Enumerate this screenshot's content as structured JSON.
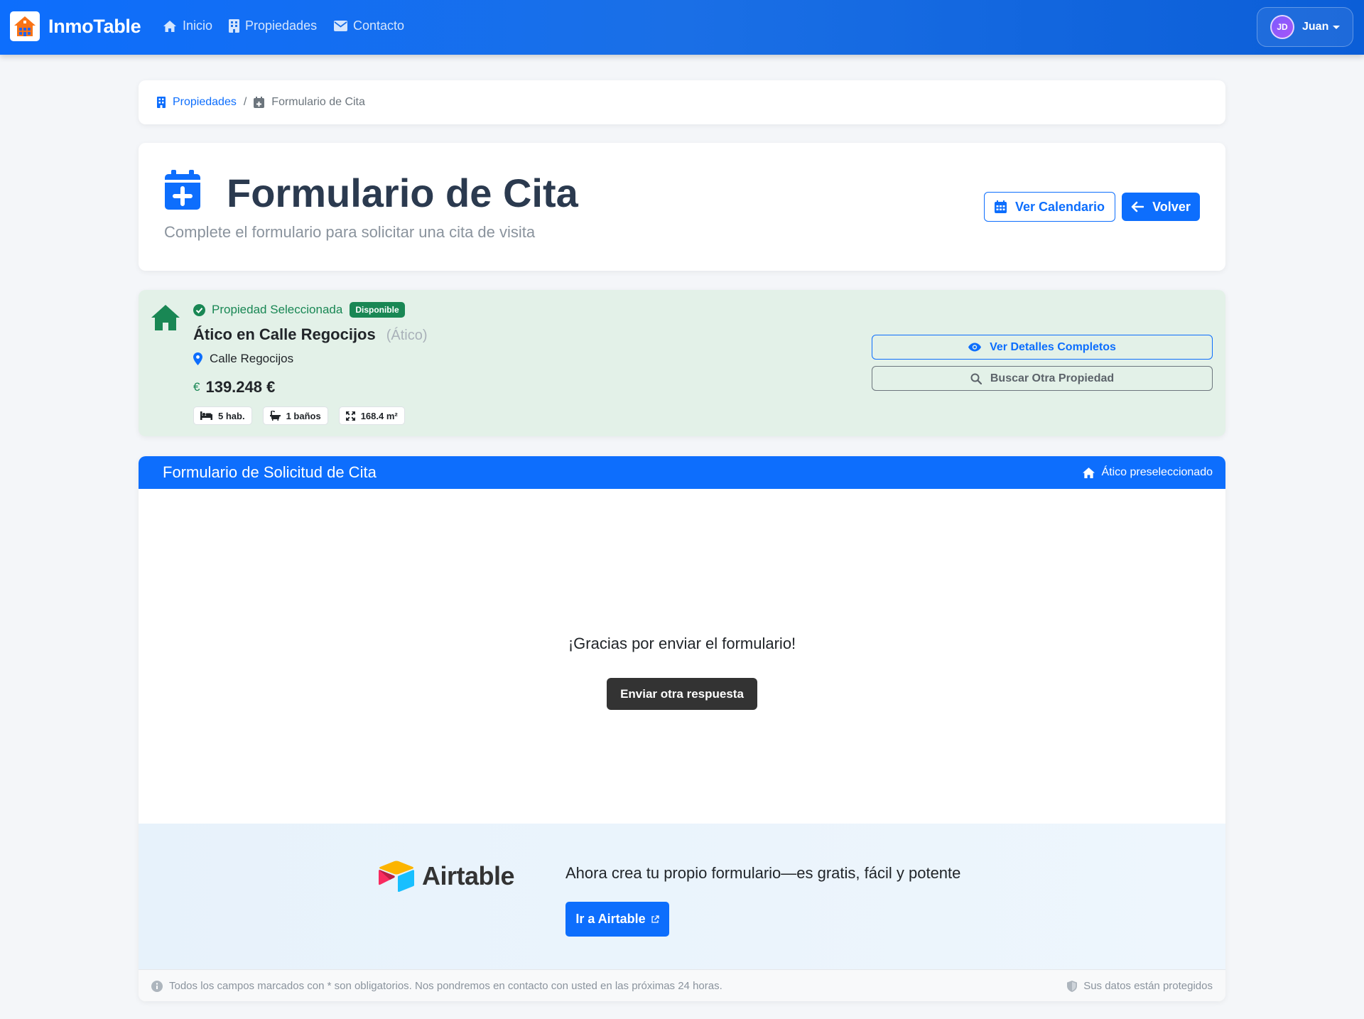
{
  "navbar": {
    "brand": "InmoTable",
    "links": [
      "Inicio",
      "Propiedades",
      "Contacto"
    ],
    "user": {
      "initials": "JD",
      "name": "Juan"
    }
  },
  "breadcrumb": {
    "parent": "Propiedades",
    "current": "Formulario de Cita"
  },
  "header": {
    "title": "Formulario de Cita",
    "subtitle": "Complete el formulario para solicitar una cita de visita",
    "calendar_button": "Ver Calendario",
    "back_button": "Volver"
  },
  "property": {
    "selected_label": "Propiedad Seleccionada",
    "status_badge": "Disponible",
    "title": "Ático en Calle Regocijos",
    "type": "(Ático)",
    "address": "Calle Regocijos",
    "currency_symbol": "€",
    "price": "139.248 €",
    "features": {
      "rooms": "5 hab.",
      "baths": "1 baños",
      "area": "168.4 m²"
    },
    "details_button": "Ver Detalles Completos",
    "search_button": "Buscar Otra Propiedad"
  },
  "form": {
    "title": "Formulario de Solicitud de Cita",
    "preselected_badge": "Ático preseleccionado",
    "thanks_message": "¡Gracias por enviar el formulario!",
    "resubmit_button": "Enviar otra respuesta",
    "airtable": {
      "logo_text": "Airtable",
      "promo": "Ahora crea tu propio formulario—es gratis, fácil y potente",
      "cta": "Ir a Airtable"
    },
    "footer_note": "Todos los campos marcados con * son obligatorios. Nos pondremos en contacto con usted en las próximas 24 horas.",
    "privacy_note": "Sus datos están protegidos"
  },
  "colors": {
    "primary": "#0d6efd",
    "success": "#198754",
    "property_bg": "#e3f1e8",
    "dark_button": "#333333"
  },
  "icons": [
    "house-logo-icon",
    "home-icon",
    "building-icon",
    "envelope-icon",
    "calendar-plus-icon",
    "calendar-icon",
    "arrow-left-icon",
    "house-icon",
    "check-circle-icon",
    "map-pin-icon",
    "bed-icon",
    "bath-icon",
    "expand-icon",
    "eye-icon",
    "search-icon",
    "external-link-icon",
    "info-icon",
    "shield-icon"
  ]
}
